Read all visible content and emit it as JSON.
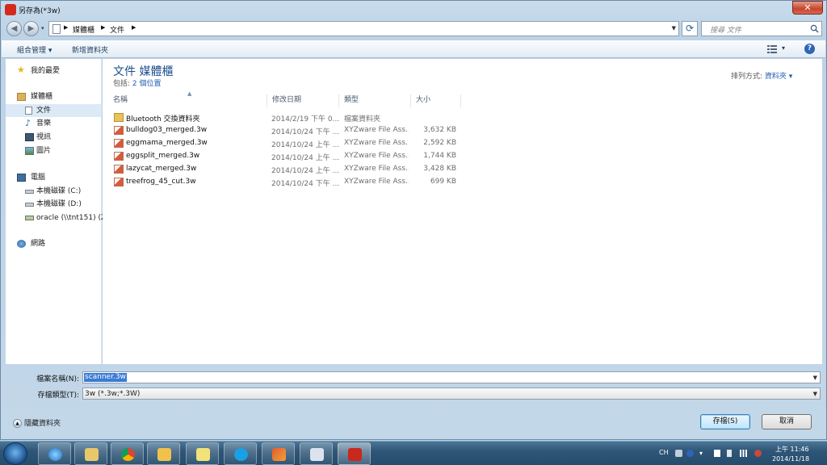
{
  "window": {
    "title": "另存為(*3w)",
    "close_label": "✕"
  },
  "nav": {
    "back": "◀",
    "forward": "▶",
    "dropdown": "▾",
    "breadcrumbs": [
      "媒體櫃",
      "文件"
    ],
    "search_placeholder": "搜尋 文件"
  },
  "toolbar": {
    "organize": "組合管理 ▾",
    "new_folder": "新增資料夾",
    "view_dropdown": "▾",
    "help": "?"
  },
  "sidebar": {
    "items": [
      {
        "label": "我的最愛",
        "icon": "star-icon"
      },
      {
        "label": "媒體櫃",
        "icon": "library-icon"
      },
      {
        "label": "文件",
        "icon": "document-icon"
      },
      {
        "label": "音樂",
        "icon": "music-icon"
      },
      {
        "label": "視訊",
        "icon": "video-icon"
      },
      {
        "label": "圖片",
        "icon": "picture-icon"
      },
      {
        "label": "電腦",
        "icon": "computer-icon"
      },
      {
        "label": "本機磁碟 (C:)",
        "icon": "drive-icon"
      },
      {
        "label": "本機磁碟 (D:)",
        "icon": "drive-icon"
      },
      {
        "label": "oracle (\\\\tnt151) (Z",
        "icon": "network-drive-icon"
      },
      {
        "label": "網路",
        "icon": "network-icon"
      }
    ]
  },
  "library": {
    "title": "文件 媒體櫃",
    "includes_label": "包括: ",
    "locations": "2 個位置",
    "arrange_label": "排列方式: ",
    "arrange_value": "資料夾 ▾"
  },
  "columns": [
    "名稱",
    "修改日期",
    "類型",
    "大小"
  ],
  "files": [
    {
      "name": "Bluetooth 交換資料夾",
      "date": "2014/2/19 下午 0...",
      "type": "檔案資料夾",
      "size": "",
      "kind": "folder"
    },
    {
      "name": "bulldog03_merged.3w",
      "date": "2014/10/24 下午 ...",
      "type": "XYZware File Ass...",
      "size": "3,632 KB",
      "kind": "file"
    },
    {
      "name": "eggmama_merged.3w",
      "date": "2014/10/24 上午 ...",
      "type": "XYZware File Ass...",
      "size": "2,592 KB",
      "kind": "file"
    },
    {
      "name": "eggsplit_merged.3w",
      "date": "2014/10/24 上午 ...",
      "type": "XYZware File Ass...",
      "size": "1,744 KB",
      "kind": "file"
    },
    {
      "name": "lazycat_merged.3w",
      "date": "2014/10/24 上午 ...",
      "type": "XYZware File Ass...",
      "size": "3,428 KB",
      "kind": "file"
    },
    {
      "name": "treefrog_45_cut.3w",
      "date": "2014/10/24 下午 ...",
      "type": "XYZware File Ass...",
      "size": "699 KB",
      "kind": "file"
    }
  ],
  "form": {
    "filename_label": "檔案名稱(N):",
    "filename_value": "scanner.3w",
    "filetype_label": "存檔類型(T):",
    "filetype_value": "3w (*.3w;*.3W)",
    "hide_folders": "隱藏資料夾",
    "save": "存檔(S)",
    "cancel": "取消"
  },
  "taskbar": {
    "lang": "CH",
    "time": "上午 11:46",
    "date": "2014/11/18"
  }
}
